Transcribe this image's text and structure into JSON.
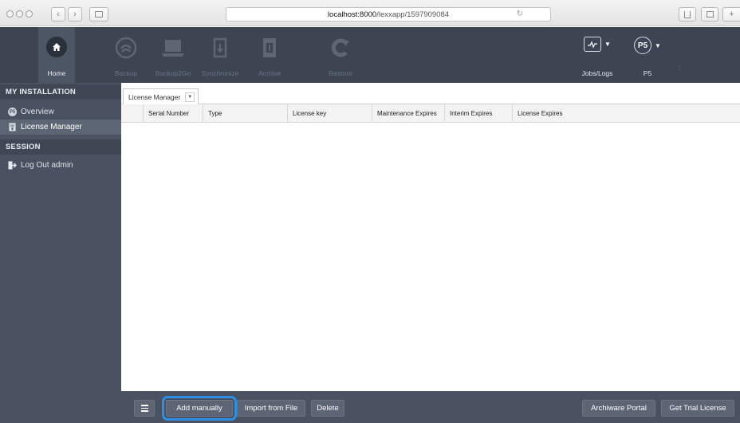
{
  "browser": {
    "url_host": "localhost:8000",
    "url_path": "/lexxapp/1597909084"
  },
  "toolbar": {
    "items": [
      {
        "id": "home",
        "label": "Home"
      },
      {
        "id": "backup",
        "label": "Backup"
      },
      {
        "id": "backup2go",
        "label": "Backup2Go"
      },
      {
        "id": "synchronize",
        "label": "Synchronize"
      },
      {
        "id": "archive",
        "label": "Archive"
      },
      {
        "id": "restore",
        "label": "Restore"
      }
    ],
    "jobs_label": "Jobs/Logs",
    "p5_label": "P5",
    "p5_badge": "P5"
  },
  "sidebar": {
    "section_installation": "MY INSTALLATION",
    "overview": "Overview",
    "license_manager": "License Manager",
    "section_session": "SESSION",
    "logout": "Log Out admin",
    "overview_badge": "P5"
  },
  "main": {
    "tab_label": "License Manager",
    "columns": [
      "Serial Number",
      "Type",
      "License key",
      "Maintenance Expires",
      "Interim Expires",
      "License Expires"
    ],
    "rows": []
  },
  "actions": {
    "add_manually": "Add manually",
    "import_from_file": "Import from File",
    "delete": "Delete",
    "archiware_portal": "Archiware Portal",
    "get_trial_license": "Get Trial License"
  },
  "colors": {
    "toolbar_bg": "#3d4553",
    "sidebar_bg": "#4a5261",
    "highlight": "#2b8fe6"
  }
}
